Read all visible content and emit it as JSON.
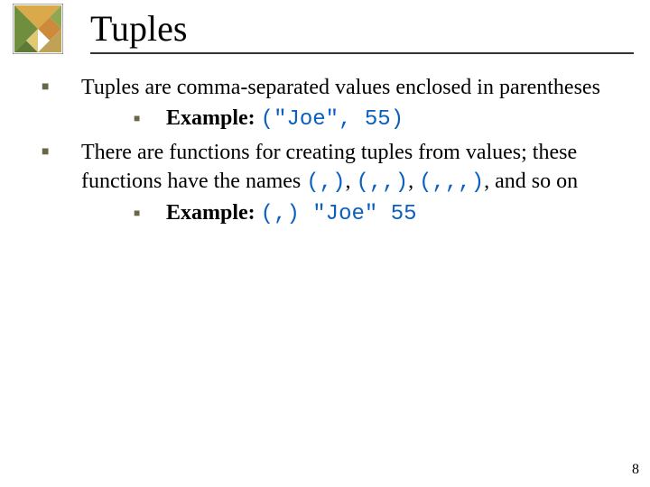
{
  "title": "Tuples",
  "bullets": {
    "a": {
      "text": "Tuples are comma-separated values enclosed in parentheses",
      "sub": {
        "label": "Example:",
        "code": "(\"Joe\", 55)"
      }
    },
    "b": {
      "t1": "There are functions for creating tuples from values; these functions have the names ",
      "c1": "(,)",
      "sep1": ", ",
      "c2": "(,,)",
      "sep2": ", ",
      "c3": "(,,,)",
      "tail": ", and so on",
      "sub": {
        "label": "Example:",
        "code": "(,) \"Joe\" 55"
      }
    }
  },
  "page_number": "8"
}
